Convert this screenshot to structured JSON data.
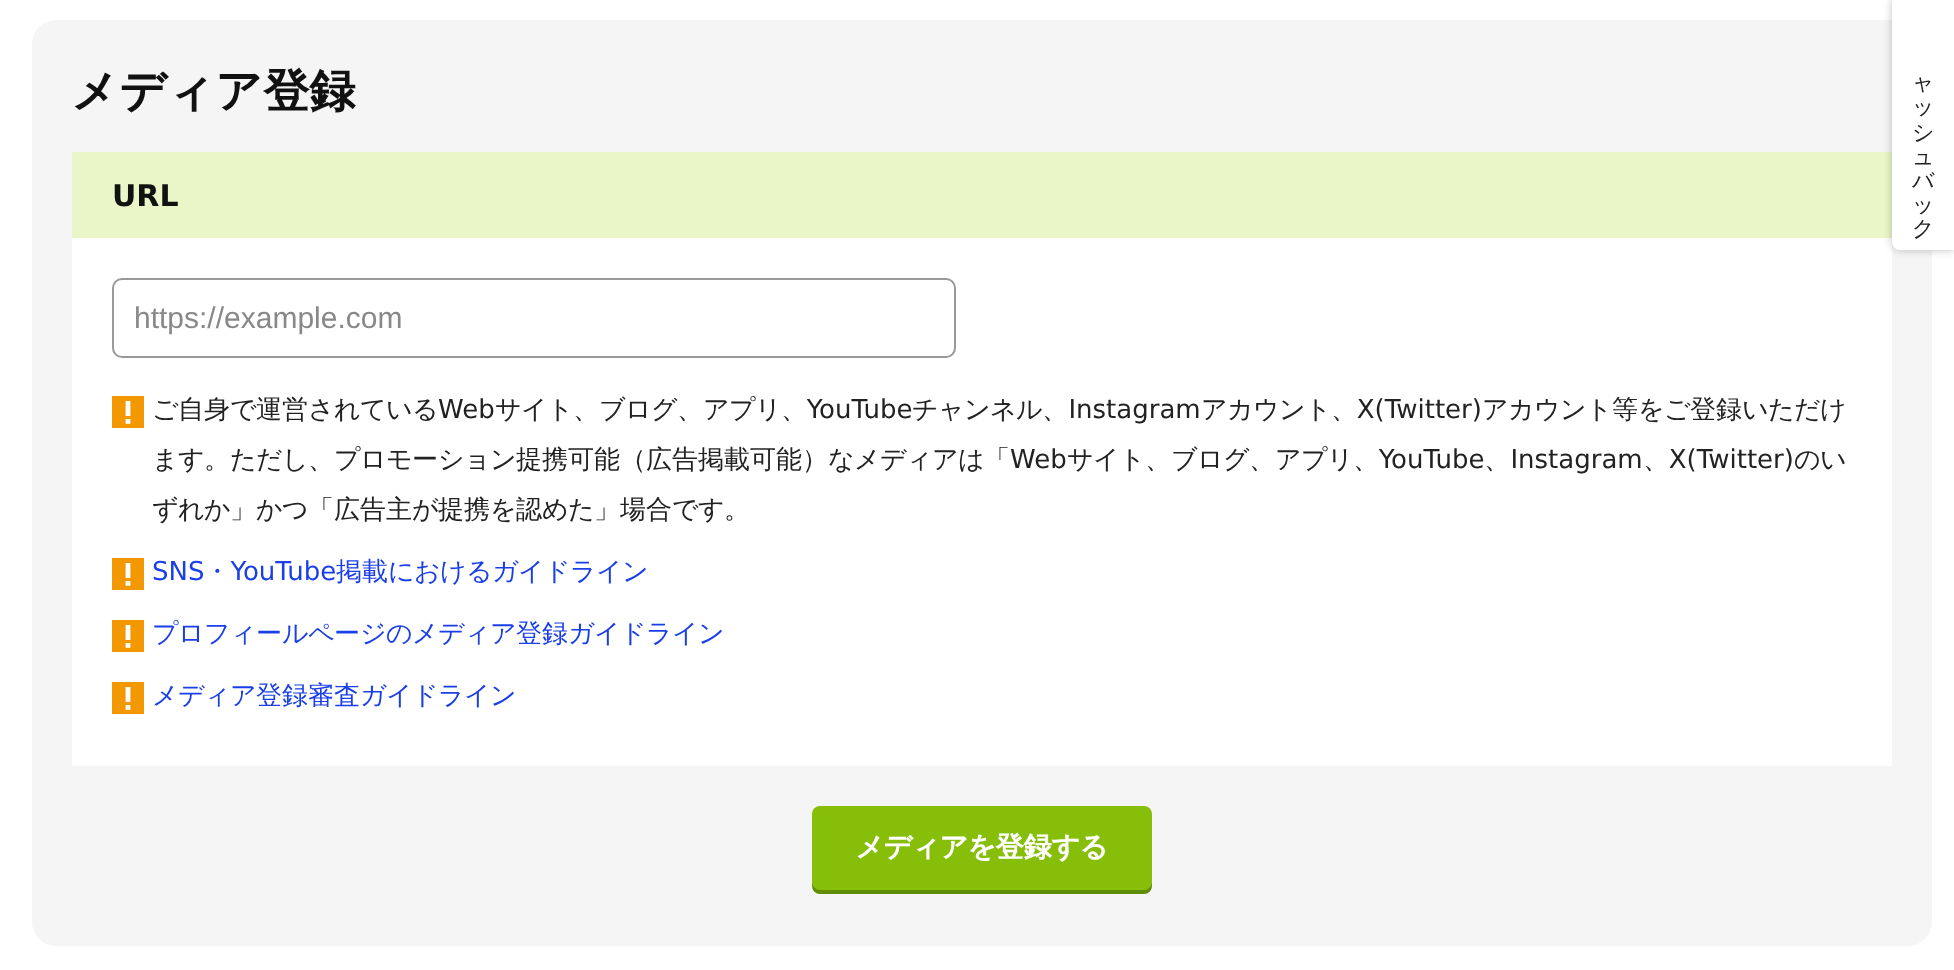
{
  "title": "メディア登録",
  "section": {
    "heading": "URL",
    "field": {
      "placeholder": "https://example.com"
    },
    "notes": [
      {
        "kind": "text",
        "text": "ご自身で運営されているWebサイト、ブログ、アプリ、YouTubeチャンネル、Instagramアカウント、X(Twitter)アカウント等をご登録いただけます。ただし、プロモーション提携可能（広告掲載可能）なメディアは「Webサイト、ブログ、アプリ、YouTube、Instagram、X(Twitter)のいずれか」かつ「広告主が提携を認めた」場合です。"
      },
      {
        "kind": "link",
        "text": "SNS・YouTube掲載におけるガイドライン"
      },
      {
        "kind": "link",
        "text": "プロフィールページのメディア登録ガイドライン"
      },
      {
        "kind": "link",
        "text": "メディア登録審査ガイドライン"
      }
    ]
  },
  "submit_button": "メディアを登録する",
  "side_tab": "ャッシュバック"
}
